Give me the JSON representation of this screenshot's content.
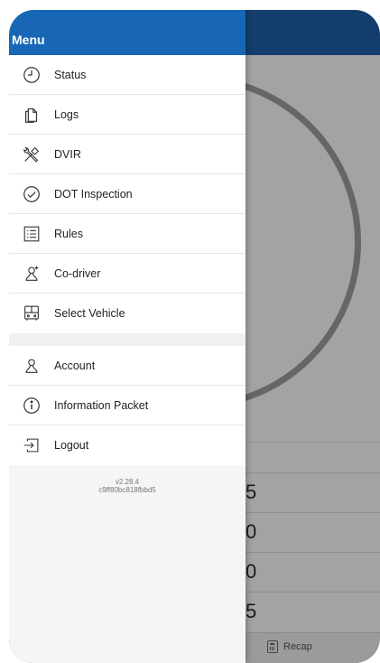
{
  "drawer": {
    "title": "Menu",
    "items_primary": [
      {
        "label": "Status",
        "icon": "clock-icon"
      },
      {
        "label": "Logs",
        "icon": "documents-icon"
      },
      {
        "label": "DVIR",
        "icon": "tools-icon"
      },
      {
        "label": "DOT Inspection",
        "icon": "check-circle-icon"
      },
      {
        "label": "Rules",
        "icon": "list-icon"
      },
      {
        "label": "Co-driver",
        "icon": "co-driver-icon"
      },
      {
        "label": "Select Vehicle",
        "icon": "bus-icon"
      }
    ],
    "items_secondary": [
      {
        "label": "Account",
        "icon": "person-icon"
      },
      {
        "label": "Information Packet",
        "icon": "info-icon"
      },
      {
        "label": "Logout",
        "icon": "logout-icon"
      }
    ],
    "version": "v2.28.4",
    "build_hash": "c9ff80bc818fbbd5"
  },
  "background": {
    "row_values": [
      "5",
      "0",
      "0",
      "5"
    ],
    "bottom_tab_label": "Recap",
    "bottom_tab_icon": "calculator-icon"
  },
  "colors": {
    "drawer_header": "#1767b6",
    "app_header_dimmed": "#143e6e",
    "overlay": "#a3a3a3"
  }
}
